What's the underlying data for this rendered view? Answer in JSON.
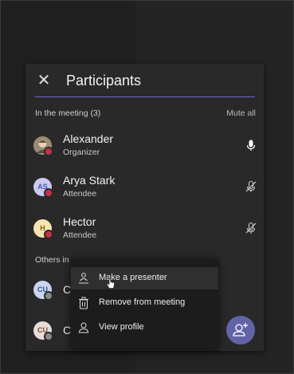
{
  "panel": {
    "title": "Participants",
    "close_icon": "close-icon",
    "accent_color": "#6b6fd0"
  },
  "in_meeting": {
    "label": "In the meeting (3)",
    "mute_all": "Mute all",
    "participants": [
      {
        "name": "Alexander",
        "role": "Organizer",
        "initials": "",
        "avatar_color": "#8d7a63",
        "mic": "mic-on-icon"
      },
      {
        "name": "Arya Stark",
        "role": "Attendee",
        "initials": "AS",
        "avatar_color": "#c9cbef",
        "mic": "mic-off-icon"
      },
      {
        "name": "Hector",
        "role": "Attendee",
        "initials": "H",
        "avatar_color": "#f6e4b1",
        "mic": "mic-off-icon"
      }
    ]
  },
  "others": {
    "label": "Others in",
    "participants": [
      {
        "name": "C.",
        "initials": "CU",
        "avatar_color": "#c9d6ee"
      },
      {
        "name": "C.",
        "initials": "CU",
        "avatar_color": "#e8dcd8"
      }
    ]
  },
  "context_menu": {
    "items": [
      {
        "label": "Make a presenter",
        "icon": "presenter-icon"
      },
      {
        "label": "Remove from meeting",
        "icon": "trash-icon"
      },
      {
        "label": "View profile",
        "icon": "profile-icon"
      }
    ]
  },
  "fab": {
    "icon": "add-person-icon",
    "color": "#6264a7"
  }
}
